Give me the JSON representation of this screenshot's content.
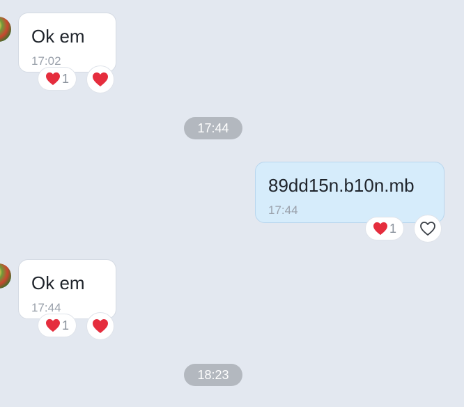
{
  "messages": [
    {
      "text": "Ok em",
      "time": "17:02",
      "reaction_count": "1"
    },
    {
      "text": "89dd15n.b10n.mb",
      "time": "17:44",
      "reaction_count": "1"
    },
    {
      "text": "Ok em",
      "time": "17:44",
      "reaction_count": "1"
    }
  ],
  "dividers": [
    "17:44",
    "18:23"
  ],
  "colors": {
    "background": "#e3e8f0",
    "incoming_bubble": "#ffffff",
    "outgoing_bubble": "#d6ecfb",
    "heart": "#e52d3d",
    "divider_chip": "#b3b8bf"
  },
  "icons": {
    "reaction": "red-heart-icon",
    "react_button_filled": "red-heart-icon",
    "react_button_outline": "heart-outline-icon"
  }
}
